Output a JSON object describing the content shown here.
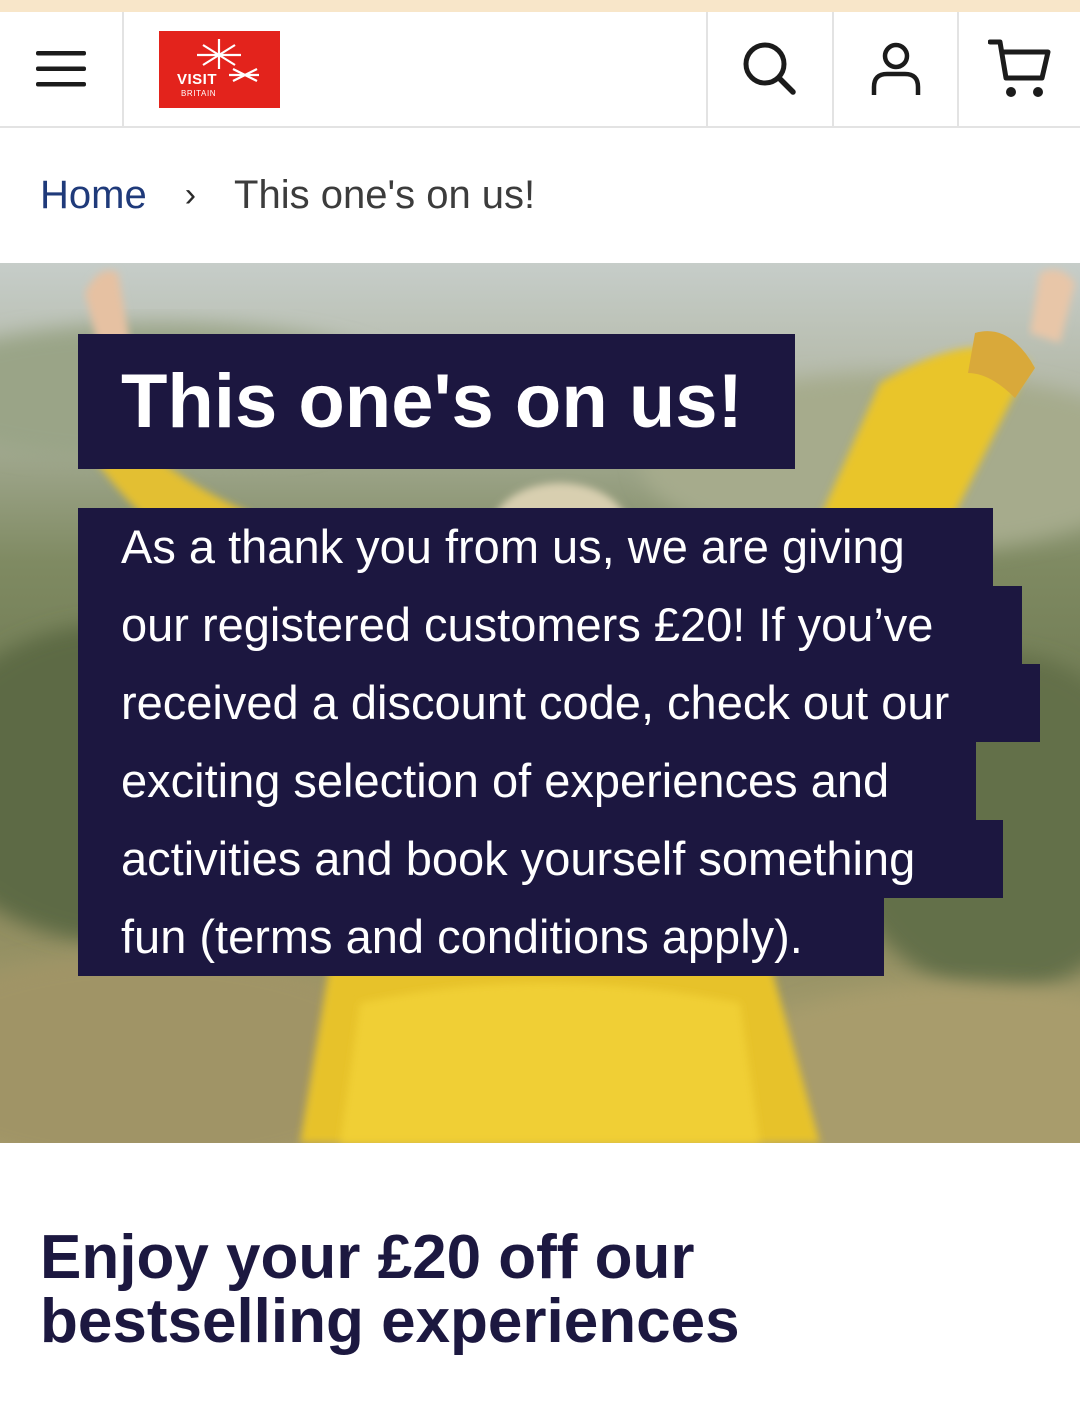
{
  "header": {
    "logo": {
      "line1": "VISIT",
      "line2": "BRITAIN",
      "brand_color": "#e3231c"
    },
    "icons": {
      "menu": "hamburger-menu-icon",
      "search": "search-icon",
      "account": "user-icon",
      "cart": "shopping-cart-icon"
    }
  },
  "breadcrumb": {
    "home": "Home",
    "separator": "›",
    "current": "This one's on us!"
  },
  "hero": {
    "title": "This one's on us!",
    "body_lines": [
      "As a thank you from us, we are giving",
      "our registered customers £20! If you’ve",
      "received a discount code, check out our",
      "exciting selection of experiences and",
      "activities and book yourself something",
      "fun (terms and conditions apply)."
    ],
    "box_color": "#1c1740"
  },
  "promo": {
    "heading_line1": "Enjoy your £20 off our",
    "heading_line2": "bestselling experiences"
  }
}
